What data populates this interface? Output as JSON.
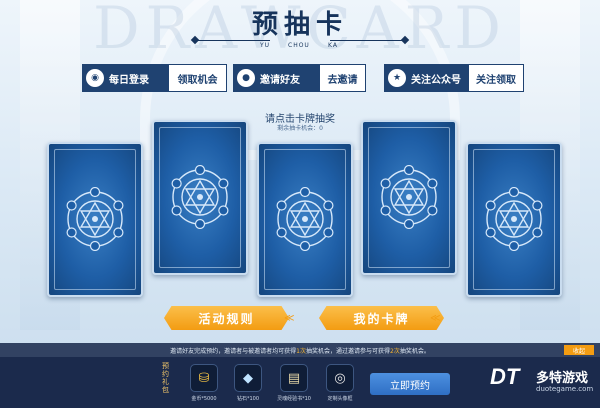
{
  "header": {
    "watermark": "DRAWCARD",
    "title": "预抽卡",
    "pinyin": [
      "YU",
      "CHOU",
      "KA"
    ]
  },
  "actions": [
    {
      "label": "每日登录",
      "button": "领取机会",
      "icon": "calendar-icon"
    },
    {
      "label": "邀请好友",
      "button": "去邀请",
      "icon": "user-icon"
    },
    {
      "label": "关注公众号",
      "button": "关注领取",
      "icon": "star-icon"
    }
  ],
  "draw": {
    "instruction": "请点击卡牌抽奖",
    "remaining": "剩余抽卡机会：0"
  },
  "buttons": {
    "rules": "活动规则",
    "my_cards": "我的卡牌"
  },
  "bottom": {
    "notice_pre": "邀请好友完成预约，邀请者与被邀请者均可获得",
    "notice_hl1": "1次",
    "notice_mid": "抽奖机会，通过邀请参与可获得",
    "notice_hl2": "2次",
    "notice_post": "抽奖机会。",
    "collapse": "收起",
    "reward_label": "预约礼包",
    "rewards": [
      {
        "icon": "gold-icon",
        "caption": "金币*5000"
      },
      {
        "icon": "diamond-icon",
        "caption": "钻石*100"
      },
      {
        "icon": "book-icon",
        "caption": "灵魂经验书*10"
      },
      {
        "icon": "headset-icon",
        "caption": "定制头像框"
      }
    ],
    "reserve": "立即预约"
  },
  "logo": {
    "mark": "DT",
    "name": "多特游戏",
    "url": "duotegame.com"
  },
  "colors": {
    "navy": "#1f4271",
    "card_blue": "#1e5ea6",
    "orange": "#f39c12"
  }
}
